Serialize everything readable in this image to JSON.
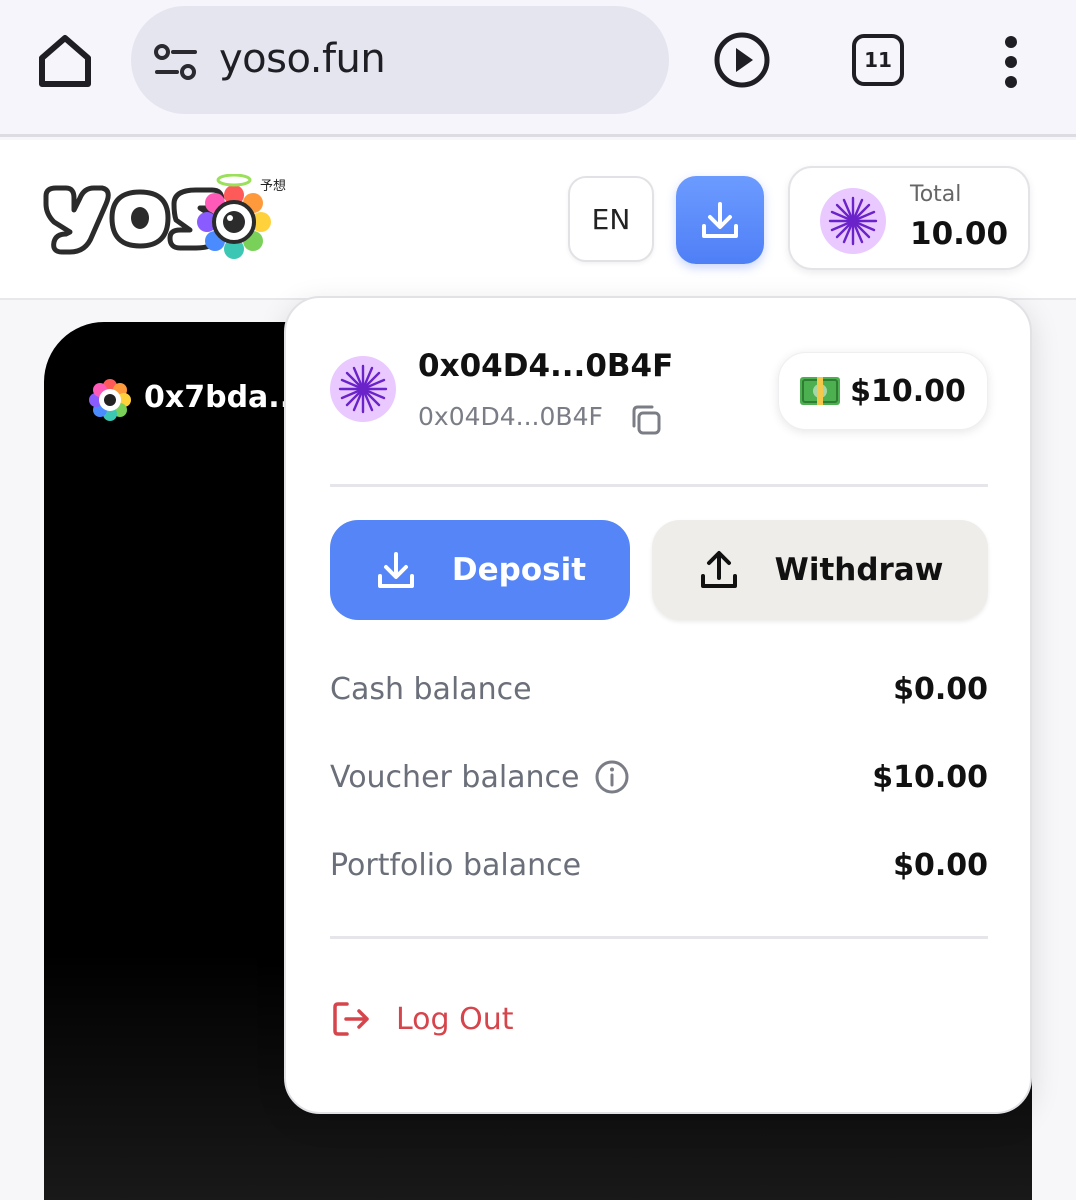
{
  "browser": {
    "url": "yoso.fun",
    "tab_count": "11"
  },
  "header": {
    "logo_subtext": "予想",
    "language": "EN",
    "total_label": "Total",
    "total_value": "10.00"
  },
  "background_card": {
    "address": "0x7bda..."
  },
  "wallet_menu": {
    "address": "0x04D4...0B4F",
    "address_short": "0x04D4...0B4F",
    "balance_badge": "$10.00",
    "deposit_label": "Deposit",
    "withdraw_label": "Withdraw",
    "balances": [
      {
        "label": "Cash balance",
        "value": "$0.00"
      },
      {
        "label": "Voucher balance",
        "value": "$10.00"
      },
      {
        "label": "Portfolio balance",
        "value": "$0.00"
      }
    ],
    "logout_label": "Log Out"
  },
  "colors": {
    "accent_blue": "#5585f6",
    "logout_red": "#d6454b",
    "avatar_purple": "#7a2cd9"
  },
  "icons": [
    "home-icon",
    "tune-icon",
    "play-icon",
    "tabs-icon",
    "more-vert-icon",
    "download-icon",
    "upload-icon",
    "copy-icon",
    "cash-icon",
    "info-icon",
    "logout-icon"
  ]
}
